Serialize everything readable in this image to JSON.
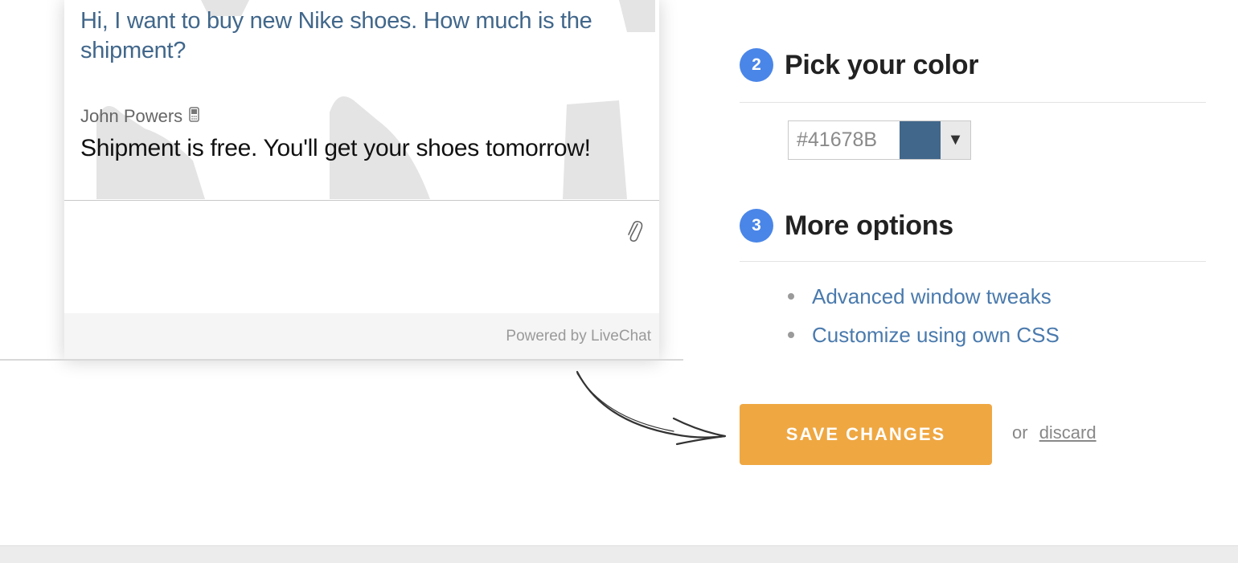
{
  "chat": {
    "customer_message": "Hi, I want to buy new Nike shoes. How much is the shipment?",
    "agent_name": "John Powers",
    "agent_message": "Shipment is free. You'll get your shoes tomorrow!",
    "powered_by": "Powered by LiveChat"
  },
  "color_section": {
    "number": "2",
    "title": "Pick your color",
    "value": "#41678B",
    "swatch_color": "#41678B",
    "dropdown_arrow": "▼"
  },
  "options_section": {
    "number": "3",
    "title": "More options",
    "links": [
      "Advanced window tweaks",
      "Customize using own CSS"
    ]
  },
  "actions": {
    "save_label": "SAVE CHANGES",
    "or_text": "or",
    "discard_label": "discard"
  },
  "colors": {
    "accent_blue": "#4a86e8",
    "link": "#4a7aad",
    "save_button": "#efa742"
  },
  "icons": [
    "mobile-phone-icon",
    "paperclip-icon",
    "arrow-icon",
    "shoe-silhouette-icon"
  ]
}
